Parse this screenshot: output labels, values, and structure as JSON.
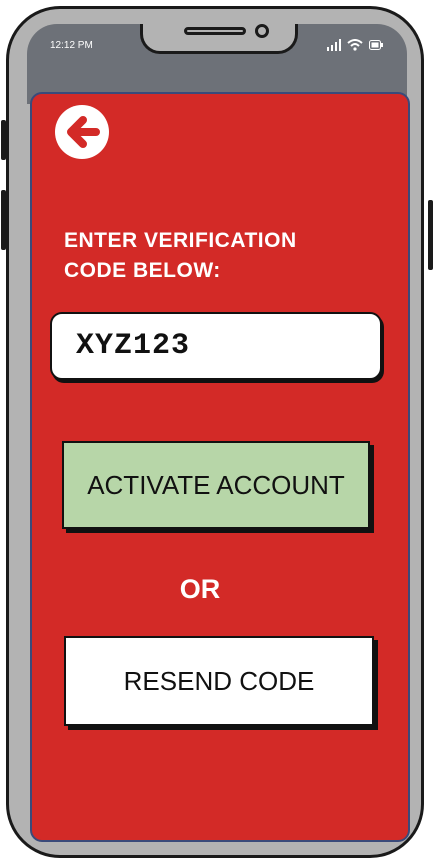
{
  "status_bar": {
    "time": "12:12 PM"
  },
  "colors": {
    "screen_bg": "#d32a27",
    "activate_bg": "#b7d6a8",
    "resend_bg": "#ffffff"
  },
  "icons": {
    "back": "arrow-left-circle-icon",
    "signal": "cellular-signal-icon",
    "wifi": "wifi-icon",
    "battery": "battery-icon"
  },
  "verification": {
    "label_line1": "ENTER VERIFICATION",
    "label_line2": "CODE BELOW:",
    "code_value": "XYZ123"
  },
  "actions": {
    "activate_label": "ACTIVATE ACCOUNT",
    "or_label": "OR",
    "resend_label": "RESEND CODE"
  }
}
